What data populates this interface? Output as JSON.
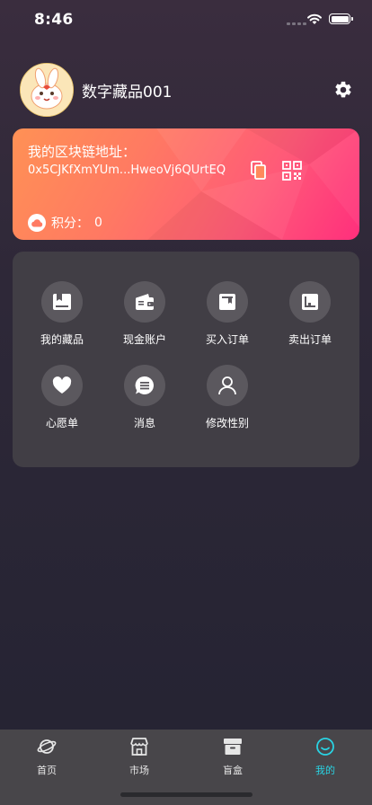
{
  "status": {
    "time": "8:46"
  },
  "profile": {
    "username": "数字藏品001"
  },
  "chain": {
    "title": "我的区块链地址：",
    "address": "0x5CJKfXmYUm...HweoVj6QUrtEQ",
    "points_label": "积分：",
    "points_value": "0"
  },
  "menu": {
    "items": [
      {
        "label": "我的藏品",
        "icon": "collection-icon"
      },
      {
        "label": "现金账户",
        "icon": "wallet-icon"
      },
      {
        "label": "买入订单",
        "icon": "buy-order-icon"
      },
      {
        "label": "卖出订单",
        "icon": "sell-order-icon"
      },
      {
        "label": "心愿单",
        "icon": "heart-icon"
      },
      {
        "label": "消息",
        "icon": "message-icon"
      },
      {
        "label": "修改性别",
        "icon": "person-icon"
      }
    ]
  },
  "tabs": [
    {
      "label": "首页",
      "icon": "planet-icon"
    },
    {
      "label": "市场",
      "icon": "shop-icon"
    },
    {
      "label": "盲盒",
      "icon": "box-icon"
    },
    {
      "label": "我的",
      "icon": "smile-icon",
      "active": true
    }
  ],
  "colors": {
    "accent": "#29d3e3",
    "card_start": "#ff9155",
    "card_end": "#ff2f7c"
  }
}
